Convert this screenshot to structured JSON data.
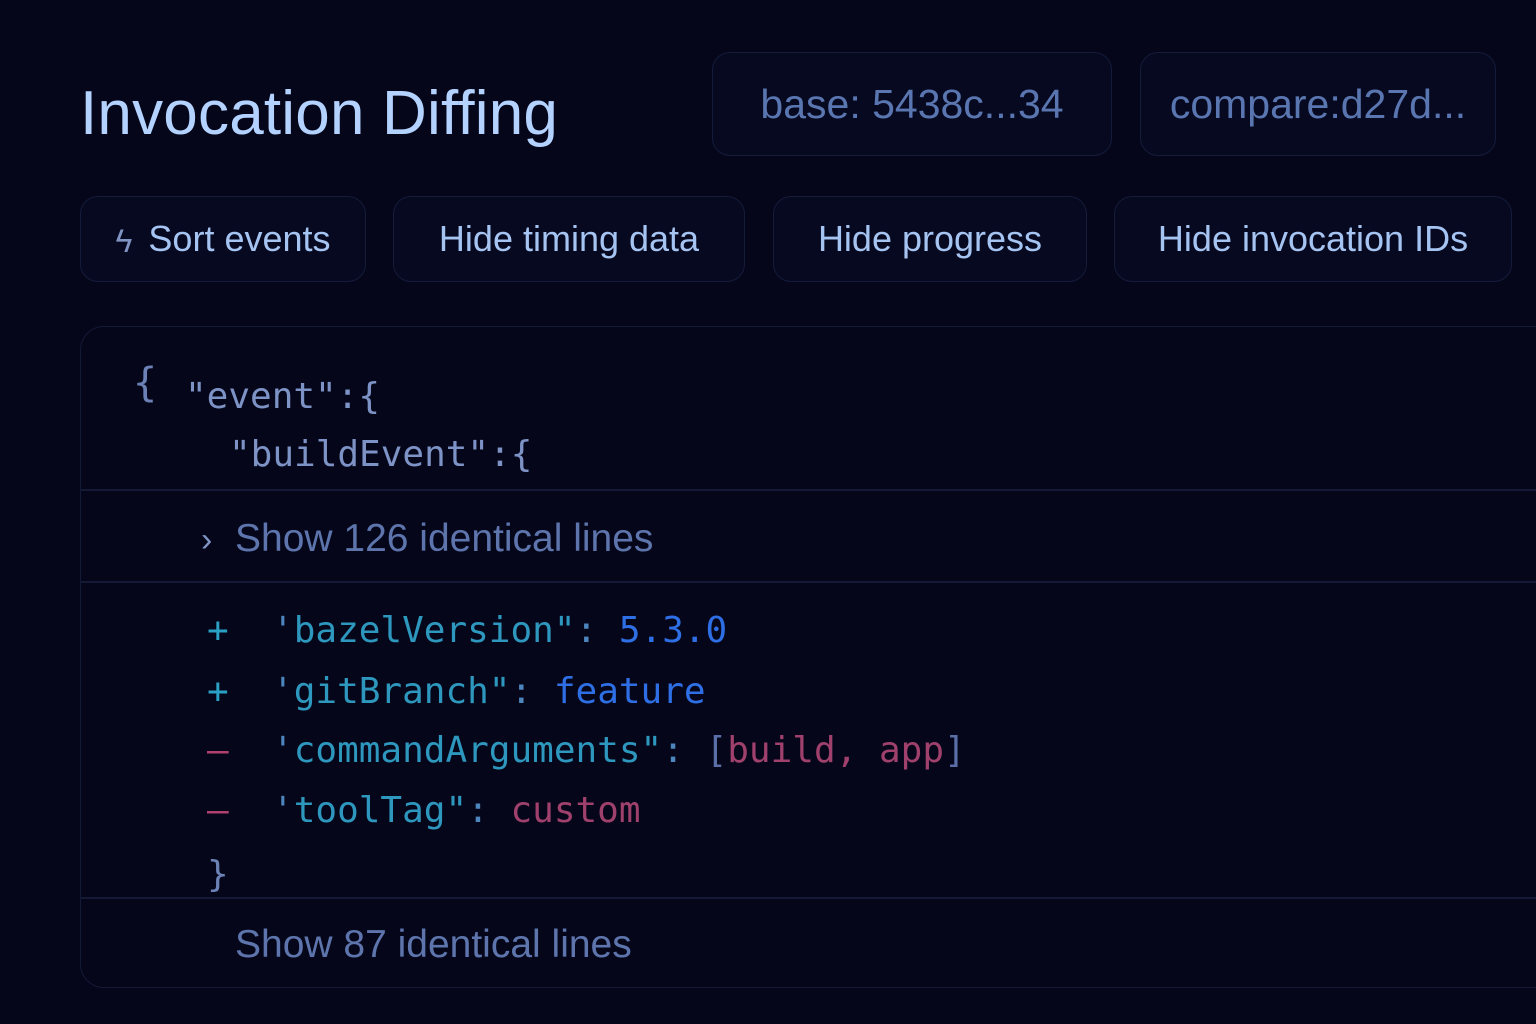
{
  "header": {
    "title": "Invocation Diffing",
    "base_label": "base: 5438c...34",
    "compare_label": "compare:d27d..."
  },
  "options": {
    "sort_icon": "sort-icon",
    "sort_glyph": "ϟ",
    "sort_label": "Sort events",
    "timing_label": "Hide timing data",
    "progress_label": "Hide progress",
    "ids_label": "Hide invocation IDs"
  },
  "diff": {
    "open_brace": "{",
    "event_line": "\"event\":{",
    "build_event_line": "\"buildEvent\":{",
    "collapse_top": {
      "chevron": "›",
      "label": "Show 126 identical lines"
    },
    "lines": [
      {
        "marker": "+",
        "quote": "'",
        "key": "bazelVersion\"",
        "colon": ": ",
        "value": "5.3.0"
      },
      {
        "marker": "+",
        "quote": "'",
        "key": "gitBranch\"",
        "colon": ": ",
        "value": "feature"
      },
      {
        "marker": "–",
        "quote": "'",
        "key": "commandArguments\"",
        "colon": ": ",
        "bracket_open": "[",
        "value": "build, app",
        "bracket_close": "]"
      },
      {
        "marker": "–",
        "quote": "'",
        "key": "toolTag\"",
        "colon": ": ",
        "value": "custom"
      }
    ],
    "close_brace": "}",
    "collapse_bottom": {
      "label": "Show 87 identical lines"
    }
  },
  "colors": {
    "background": "#05061a",
    "title": "#b3d2ff",
    "added": "#2aa0c4",
    "removed": "#b0406e",
    "added_value": "#2f6fe6"
  }
}
